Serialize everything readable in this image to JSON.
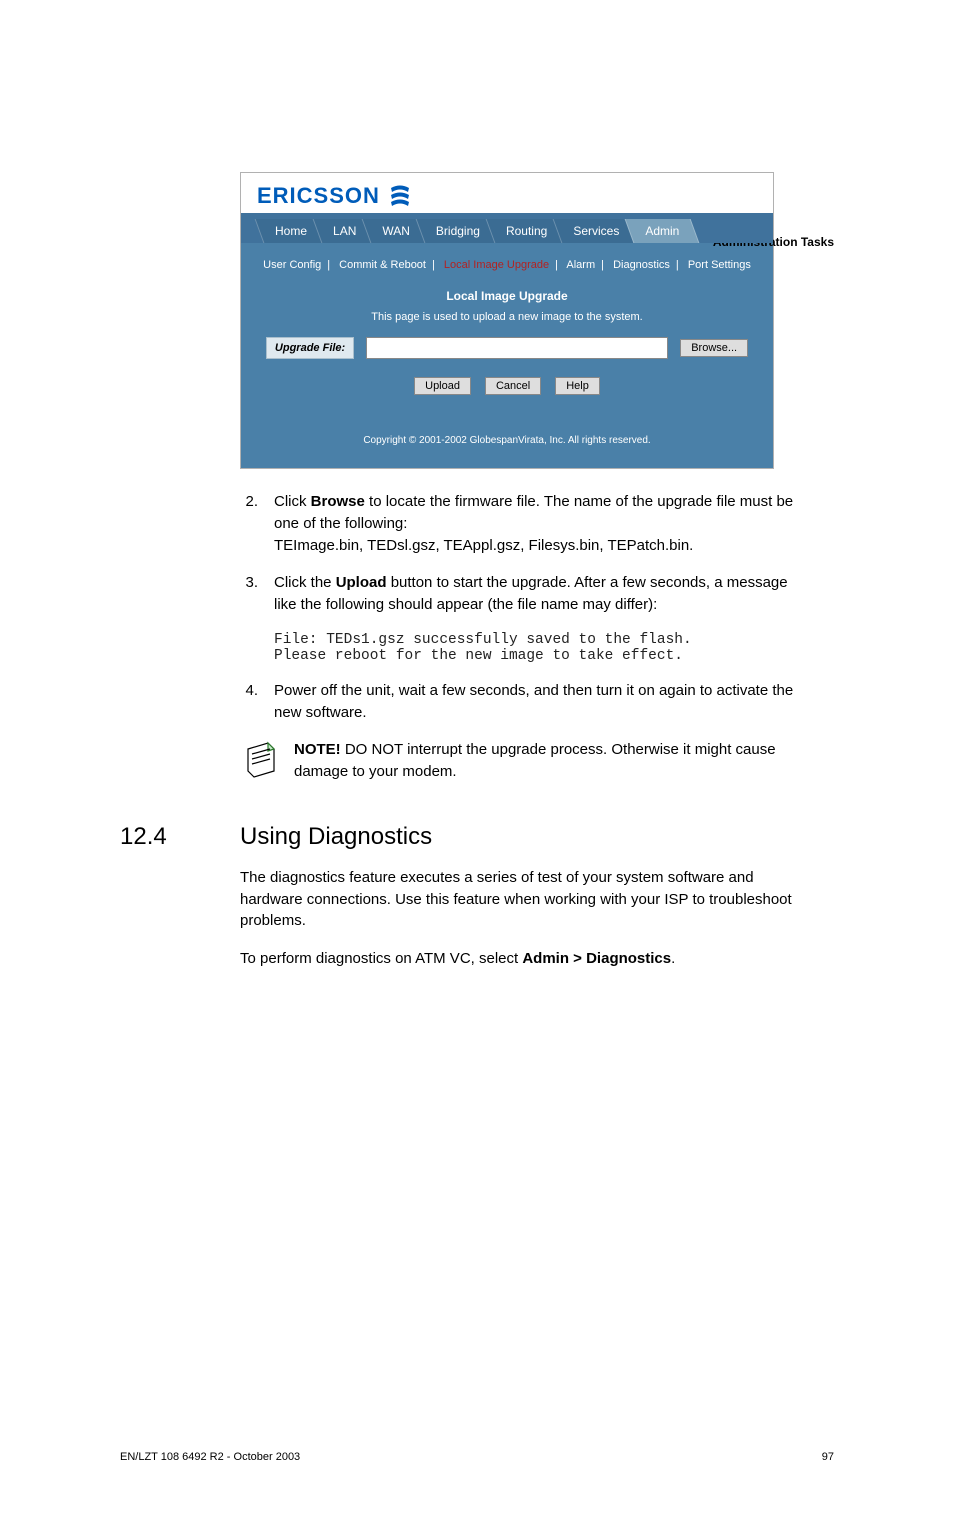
{
  "header": {
    "section_title": "Administration Tasks"
  },
  "screenshot": {
    "brand": "ERICSSON",
    "tabs": [
      "Home",
      "LAN",
      "WAN",
      "Bridging",
      "Routing",
      "Services",
      "Admin"
    ],
    "tab_selected": 6,
    "subnav": {
      "items": [
        "User Config",
        "Commit & Reboot",
        "Local Image Upgrade",
        "Alarm",
        "Diagnostics",
        "Port Settings"
      ],
      "active_index": 2
    },
    "panel_title": "Local Image Upgrade",
    "panel_sub": "This page is used to upload a new image to the system.",
    "upgrade_label": "Upgrade File:",
    "browse_label": "Browse...",
    "buttons": [
      "Upload",
      "Cancel",
      "Help"
    ],
    "copyright": "Copyright © 2001-2002 GlobespanVirata, Inc. All rights reserved."
  },
  "steps": {
    "s2": {
      "num": "2.",
      "text_a": "Click ",
      "bold_a": "Browse",
      "text_b": " to locate the firmware file. The name of the upgrade file must be one of the following:",
      "text_c": "TEImage.bin, TEDsl.gsz, TEAppl.gsz, Filesys.bin, TEPatch.bin."
    },
    "s3": {
      "num": "3.",
      "text_a": "Click the ",
      "bold_a": "Upload",
      "text_b": " button to start the upgrade. After a few seconds, a message like the following should appear (the file name may differ):",
      "code": "File: TEDs1.gsz successfully saved to the flash.\nPlease reboot for the new image to take effect."
    },
    "s4": {
      "num": "4.",
      "text": "Power off the unit, wait a few seconds, and then turn it on again to activate the new software."
    }
  },
  "note": {
    "bold": "NOTE!",
    "text": " DO NOT interrupt the upgrade process. Otherwise it might cause damage to your modem."
  },
  "section": {
    "number": "12.4",
    "title": "Using Diagnostics",
    "p1": "The diagnostics feature executes a series of test of your system software and hardware connections. Use this feature when working with your ISP to troubleshoot problems.",
    "p2_a": "To perform diagnostics on ATM VC, select ",
    "p2_b": "Admin > Diagnostics",
    "p2_c": "."
  },
  "footer": {
    "left": "EN/LZT 108 6492 R2 - October 2003",
    "right": "97"
  }
}
